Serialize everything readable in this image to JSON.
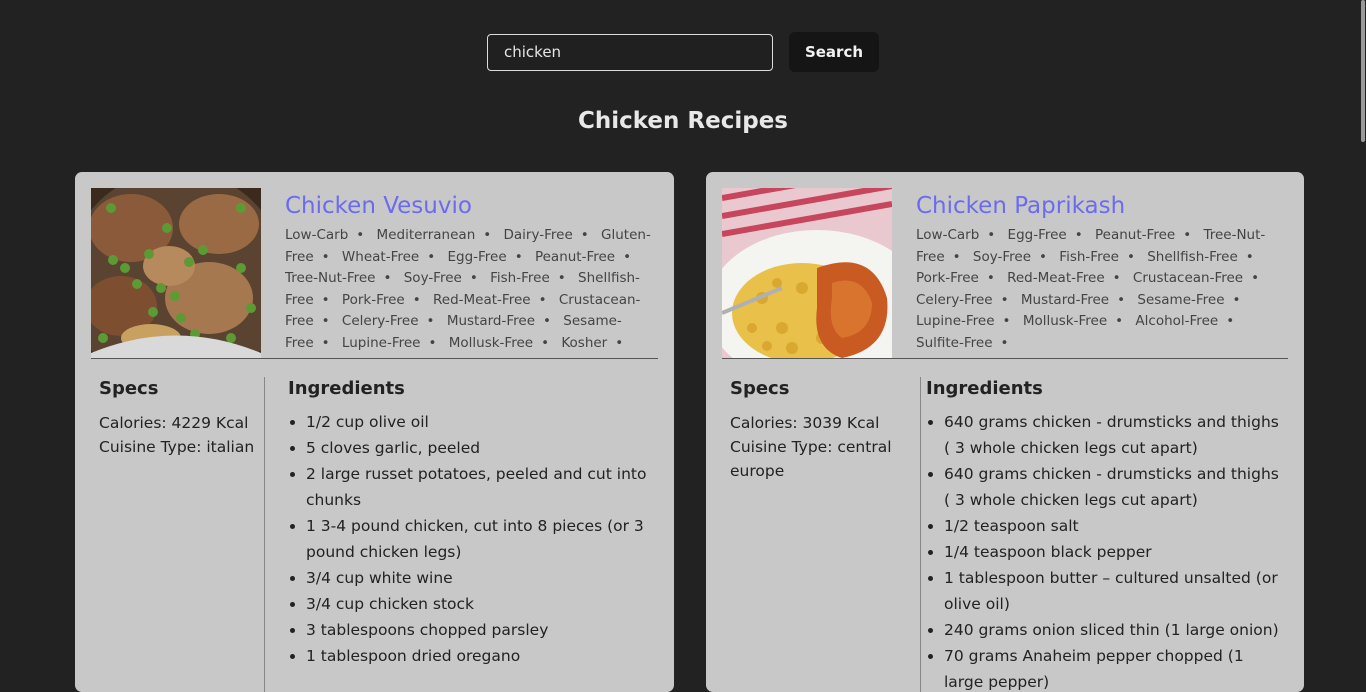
{
  "search": {
    "value": "chicken",
    "button_label": "Search"
  },
  "page_title": "Chicken Recipes",
  "recipes": [
    {
      "title": "Chicken Vesuvio",
      "labels": [
        "Low-Carb",
        "Mediterranean",
        "Dairy-Free",
        "Gluten-Free",
        "Wheat-Free",
        "Egg-Free",
        "Peanut-Free",
        "Tree-Nut-Free",
        "Soy-Free",
        "Fish-Free",
        "Shellfish-Free",
        "Pork-Free",
        "Red-Meat-Free",
        "Crustacean-Free",
        "Celery-Free",
        "Mustard-Free",
        "Sesame-Free",
        "Lupine-Free",
        "Mollusk-Free",
        "Kosher"
      ],
      "specs_heading": "Specs",
      "calories": "Calories: 4229 Kcal",
      "cuisine": "Cuisine Type: italian",
      "ingredients_heading": "Ingredients",
      "ingredients": [
        "1/2 cup olive oil",
        "5 cloves garlic, peeled",
        "2 large russet potatoes, peeled and cut into chunks",
        "1 3-4 pound chicken, cut into 8 pieces (or 3 pound chicken legs)",
        "3/4 cup white wine",
        "3/4 cup chicken stock",
        "3 tablespoons chopped parsley",
        "1 tablespoon dried oregano"
      ]
    },
    {
      "title": "Chicken Paprikash",
      "labels": [
        "Low-Carb",
        "Egg-Free",
        "Peanut-Free",
        "Tree-Nut-Free",
        "Soy-Free",
        "Fish-Free",
        "Shellfish-Free",
        "Pork-Free",
        "Red-Meat-Free",
        "Crustacean-Free",
        "Celery-Free",
        "Mustard-Free",
        "Sesame-Free",
        "Lupine-Free",
        "Mollusk-Free",
        "Alcohol-Free",
        "Sulfite-Free"
      ],
      "specs_heading": "Specs",
      "calories": "Calories: 3039 Kcal",
      "cuisine": "Cuisine Type: central europe",
      "ingredients_heading": "Ingredients",
      "ingredients": [
        "640 grams chicken - drumsticks and thighs ( 3 whole chicken legs cut apart)",
        "640 grams chicken - drumsticks and thighs ( 3 whole chicken legs cut apart)",
        "1/2 teaspoon salt",
        "1/4 teaspoon black pepper",
        "1 tablespoon butter – cultured unsalted (or olive oil)",
        "240 grams onion sliced thin (1 large onion)",
        "70 grams Anaheim pepper chopped (1 large pepper)"
      ]
    }
  ],
  "colors": {
    "background": "#222222",
    "card": "#c8c8c8",
    "title_link": "#6b6bf0"
  }
}
